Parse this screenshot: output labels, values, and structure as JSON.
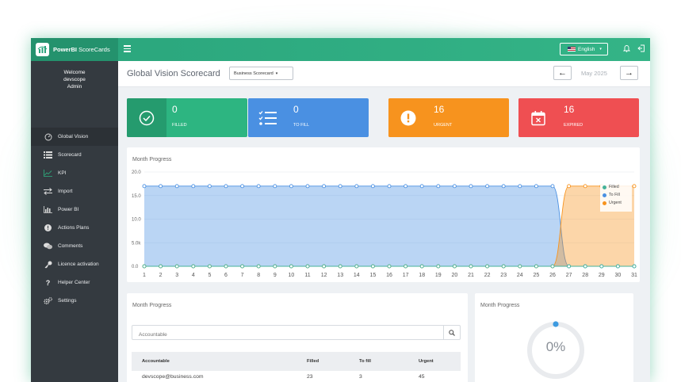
{
  "app": {
    "brand_bold": "PowerBI",
    "brand_rest": " ScoreCards",
    "language": "English"
  },
  "user": {
    "welcome": "Welcome",
    "name": "devscope",
    "role": "Admin"
  },
  "sidebar": {
    "items": [
      {
        "label": "Global Vision",
        "icon": "dashboard-gauge-icon",
        "active": true
      },
      {
        "label": "Scorecard",
        "icon": "list-icon",
        "active": false
      },
      {
        "label": "KPI",
        "icon": "line-chart-icon",
        "active": false
      },
      {
        "label": "Import",
        "icon": "exchange-arrows-icon",
        "active": false
      },
      {
        "label": "Power BI",
        "icon": "bar-chart-icon",
        "active": false
      },
      {
        "label": "Actions Plans",
        "icon": "exclamation-circle-icon",
        "active": false
      },
      {
        "label": "Comments",
        "icon": "comments-icon",
        "active": false
      },
      {
        "label": "Licence activation",
        "icon": "key-icon",
        "active": false
      },
      {
        "label": "Helper Center",
        "icon": "question-icon",
        "active": false
      },
      {
        "label": "Settings",
        "icon": "gears-icon",
        "active": false
      }
    ]
  },
  "header": {
    "title": "Global Vision Scorecard",
    "scorecard_select": "Business Scorecard",
    "month": "May 2025"
  },
  "cards": [
    {
      "value": "0",
      "label": "FILLED",
      "color": "#2db581",
      "icon_bg": "#259b6e",
      "icon": "check-circle-icon"
    },
    {
      "value": "0",
      "label": "TO FILL",
      "color": "#4a90e2",
      "icon_bg": "#3f7fd0",
      "icon": "checklist-icon"
    },
    {
      "value": "16",
      "label": "URGENT",
      "color": "#f7931e",
      "icon_bg": "#e8860f",
      "icon": "alert-circle-icon"
    },
    {
      "value": "16",
      "label": "EXPIRED",
      "color": "#ef4f52",
      "icon_bg": "#dc3f43",
      "icon": "calendar-x-icon"
    }
  ],
  "month_progress_chart": {
    "title": "Month Progress"
  },
  "chart_data": {
    "type": "area",
    "x": [
      1,
      2,
      3,
      4,
      5,
      6,
      7,
      8,
      9,
      10,
      11,
      12,
      13,
      14,
      15,
      16,
      17,
      18,
      19,
      20,
      21,
      22,
      23,
      24,
      25,
      26,
      27,
      28,
      29,
      30,
      31
    ],
    "yticks": [
      "0.0",
      "5.0k",
      "10.0",
      "15.0",
      "20.0"
    ],
    "ylim": [
      0,
      20
    ],
    "series": [
      {
        "name": "Filled",
        "color": "#45b39a",
        "values": [
          0,
          0,
          0,
          0,
          0,
          0,
          0,
          0,
          0,
          0,
          0,
          0,
          0,
          0,
          0,
          0,
          0,
          0,
          0,
          0,
          0,
          0,
          0,
          0,
          0,
          0,
          0,
          0,
          0,
          0,
          0
        ]
      },
      {
        "name": "To Fill",
        "color": "#4a90e2",
        "values": [
          17,
          17,
          17,
          17,
          17,
          17,
          17,
          17,
          17,
          17,
          17,
          17,
          17,
          17,
          17,
          17,
          17,
          17,
          17,
          17,
          17,
          17,
          17,
          17,
          17,
          17,
          0,
          0,
          0,
          0,
          0
        ]
      },
      {
        "name": "Urgent",
        "color": "#f7931e",
        "values": [
          0,
          0,
          0,
          0,
          0,
          0,
          0,
          0,
          0,
          0,
          0,
          0,
          0,
          0,
          0,
          0,
          0,
          0,
          0,
          0,
          0,
          0,
          0,
          0,
          0,
          0,
          17,
          17,
          17,
          17,
          17
        ]
      }
    ],
    "legend_position": "top-right",
    "grid": true
  },
  "table_panel": {
    "title": "Month Progress",
    "search_placeholder": "Accountable",
    "columns": [
      "Accountable",
      "Filled",
      "To fill",
      "Urgent"
    ],
    "rows": [
      [
        "devscope@business.com",
        "23",
        "3",
        "45"
      ]
    ]
  },
  "donut_panel": {
    "title": "Month Progress",
    "value_text": "0%",
    "progress": 0
  }
}
